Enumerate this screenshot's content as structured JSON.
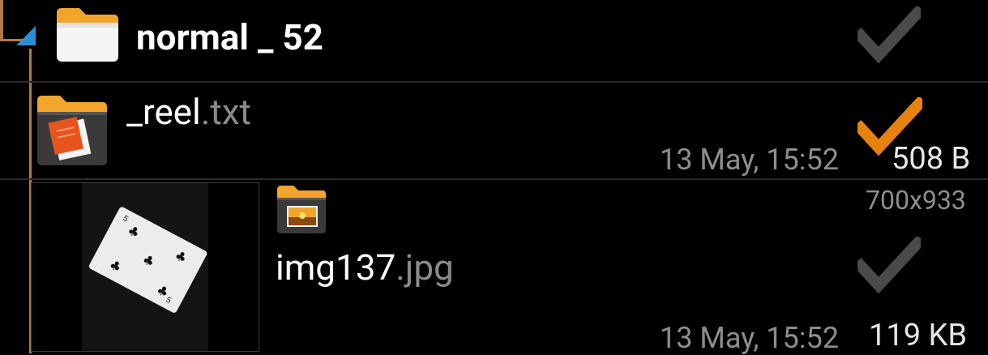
{
  "folder": {
    "name": "normal _ 52",
    "icon": "folder-icon",
    "expand_icon": "expanded-triangle-icon",
    "checked": false
  },
  "files": [
    {
      "name": "_reel",
      "ext": ".txt",
      "icon": "text-file-icon",
      "date": "13 May, 15:52",
      "size": "508 B",
      "checked": true
    },
    {
      "name": "img137",
      "ext": ".jpg",
      "icon": "image-file-icon",
      "dimensions": "700x933",
      "date": "13 May, 15:52",
      "size": "119 KB",
      "checked": false,
      "thumbnail": "playing-card-thumbnail"
    }
  ],
  "colors": {
    "background": "#000000",
    "tree_line": "#b07a4a",
    "check_active": "#e8820e",
    "check_inactive": "#4a4a4a",
    "expand_triangle": "#2a8fd6",
    "folder_orange": "#f2a52b"
  }
}
